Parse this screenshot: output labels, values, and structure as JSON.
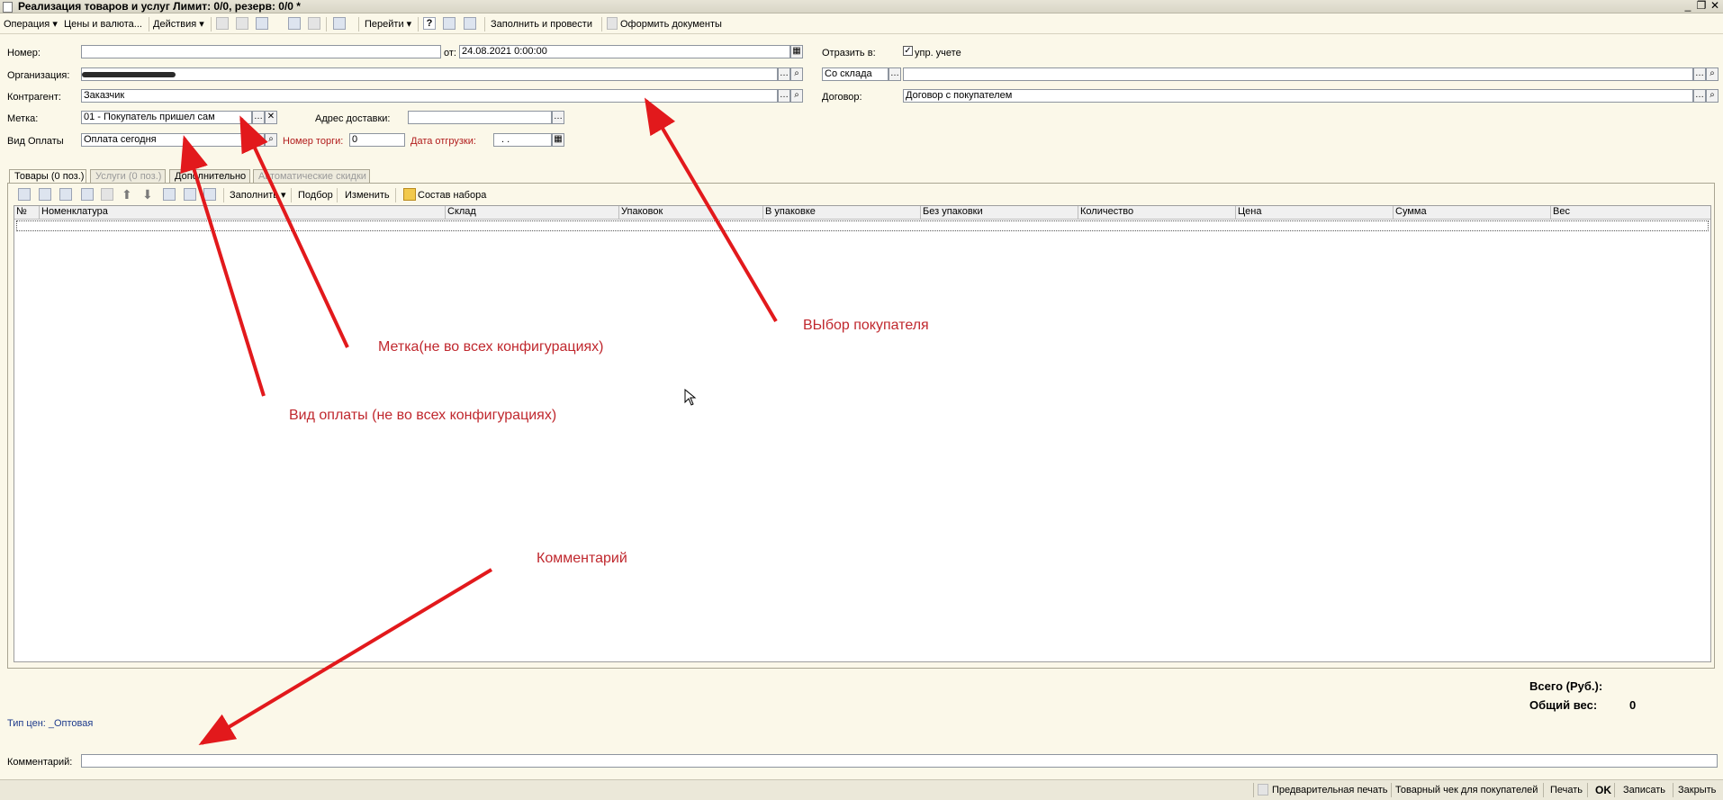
{
  "window": {
    "title": "Реализация товаров и услуг Лимит: 0/0, резерв: 0/0 *",
    "controls": [
      "_",
      "❐",
      "✕"
    ]
  },
  "toolbar": {
    "operation": "Операция ▾",
    "prices": "Цены и валюта...",
    "actions": "Действия ▾",
    "goto": "Перейти ▾",
    "help": "?",
    "fill_post": "Заполнить и провести",
    "make_docs": "Оформить документы"
  },
  "header": {
    "number_label": "Номер:",
    "number_value": "",
    "date_label": "от:",
    "date_value": "24.08.2021  0:00:00",
    "org_label": "Организация:",
    "org_value": "",
    "contractor_label": "Контрагент:",
    "contractor_value": "Заказчик",
    "tag_label": "Метка:",
    "tag_value": "01 - Покупатель пришел сам",
    "delivery_label": "Адрес доставки:",
    "delivery_value": "",
    "payment_label": "Вид Оплаты",
    "payment_value": "Оплата сегодня",
    "auction_label": "Номер торги:",
    "auction_value": "0",
    "ship_date_label": "Дата отгрузки:",
    "ship_date_value": ". .",
    "reflect_label": "Отразить в:",
    "mgmt_label": "упр. учете",
    "mgmt_checked": "✓",
    "warehouse_mode": "Со склада",
    "warehouse_value": "",
    "contract_label": "Договор:",
    "contract_value": "Договор с покупателем"
  },
  "tabs": [
    {
      "label": "Товары (0 поз.)"
    },
    {
      "label": "Услуги (0 поз.)"
    },
    {
      "label": "Дополнительно"
    },
    {
      "label": "Автоматические скидки"
    }
  ],
  "grid_toolbar": {
    "fill": "Заполнить ▾",
    "pick": "Подбор",
    "edit": "Изменить",
    "set": "Состав набора"
  },
  "table": {
    "columns": [
      "№",
      "Номенклатура",
      "Склад",
      "Упаковок",
      "В упаковке",
      "Без упаковки",
      "Количество",
      "Цена",
      "Сумма",
      "Вес"
    ]
  },
  "totals": {
    "total_label": "Всего (Руб.):",
    "total_value": "",
    "weight_label": "Общий вес:",
    "weight_value": "0"
  },
  "price_type": "Тип цен: _Оптовая",
  "comment": {
    "label": "Комментарий:",
    "value": ""
  },
  "annotations": {
    "buyer": "ВЫбор покупателя",
    "tag": "Метка(не во всех конфигурациях)",
    "payment": "Вид оплаты (не во всех конфигурациях)",
    "comment": "Комментарий"
  },
  "statusbar": {
    "preview": "Предварительная печать",
    "receipt": "Товарный чек для покупателей",
    "print": "Печать",
    "ok": "OK",
    "save": "Записать",
    "close": "Закрыть"
  },
  "colors": {
    "background": "#fbf8e9",
    "annotation": "#c0282e",
    "arrow": "#e2191c",
    "accent_label": "#b11c1c",
    "link": "#1d3a8c"
  }
}
